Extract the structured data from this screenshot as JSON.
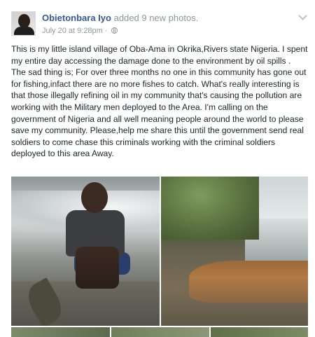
{
  "post": {
    "author": "Obietonbara Iyo",
    "action": "added 9 new photos.",
    "timestamp": "July 20 at 9:28pm",
    "separator": "·",
    "privacy_icon": "globe-icon",
    "menu_icon": "chevron-down-icon",
    "paragraphs": [
      "This is my little island village of Oba-Ama in Okrika,Rivers state Nigeria. I spent my entire day accessing the damage done to the environment by oil spills .",
      "The sad thing is; For over three months no one in this community has gone out for fishing,infact there are no more fishes to catch. What's really interesting is that those illegally refining oil in my community that's causing the pollution are working with the Military men deployed to the Area. I'm calling on the government of Nigeria and all well meaning people around the world to please save my community. Please,help me share this until the government send real soldiers to come chase this criminals working with the criminal soldiers deployed to this area Away."
    ]
  },
  "colors": {
    "author_link": "#365899",
    "meta_text": "#90949c",
    "body_text": "#1d2129"
  }
}
